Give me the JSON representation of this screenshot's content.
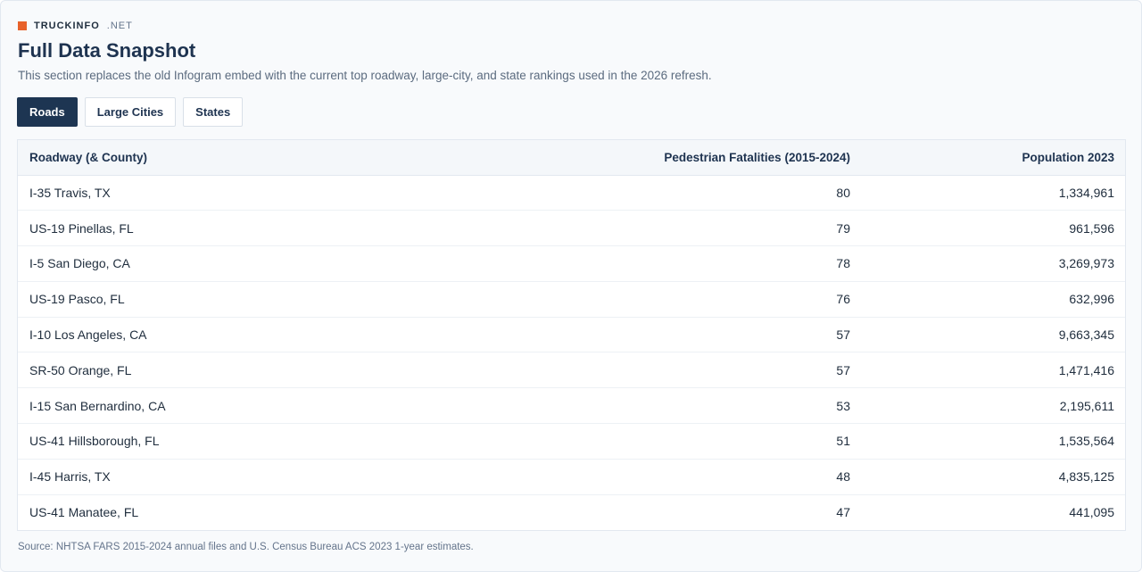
{
  "brand": {
    "name": "TRUCKINFO",
    "tld": ".NET",
    "accent": "#e8622a"
  },
  "title": "Full Data Snapshot",
  "subtitle": "This section replaces the old Infogram embed with the current top roadway, large-city, and state rankings used in the 2026 refresh.",
  "tabs": [
    {
      "label": "Roads",
      "active": true
    },
    {
      "label": "Large Cities",
      "active": false
    },
    {
      "label": "States",
      "active": false
    }
  ],
  "table": {
    "headers": [
      "Roadway (& County)",
      "Pedestrian Fatalities (2015-2024)",
      "Population 2023"
    ],
    "rows": [
      [
        "I-35 Travis, TX",
        "80",
        "1,334,961"
      ],
      [
        "US-19 Pinellas, FL",
        "79",
        "961,596"
      ],
      [
        "I-5 San Diego, CA",
        "78",
        "3,269,973"
      ],
      [
        "US-19 Pasco, FL",
        "76",
        "632,996"
      ],
      [
        "I-10 Los Angeles, CA",
        "57",
        "9,663,345"
      ],
      [
        "SR-50 Orange, FL",
        "57",
        "1,471,416"
      ],
      [
        "I-15 San Bernardino, CA",
        "53",
        "2,195,611"
      ],
      [
        "US-41 Hillsborough, FL",
        "51",
        "1,535,564"
      ],
      [
        "I-45 Harris, TX",
        "48",
        "4,835,125"
      ],
      [
        "US-41 Manatee, FL",
        "47",
        "441,095"
      ]
    ]
  },
  "source": "Source: NHTSA FARS 2015-2024 annual files and U.S. Census Bureau ACS 2023 1-year estimates."
}
